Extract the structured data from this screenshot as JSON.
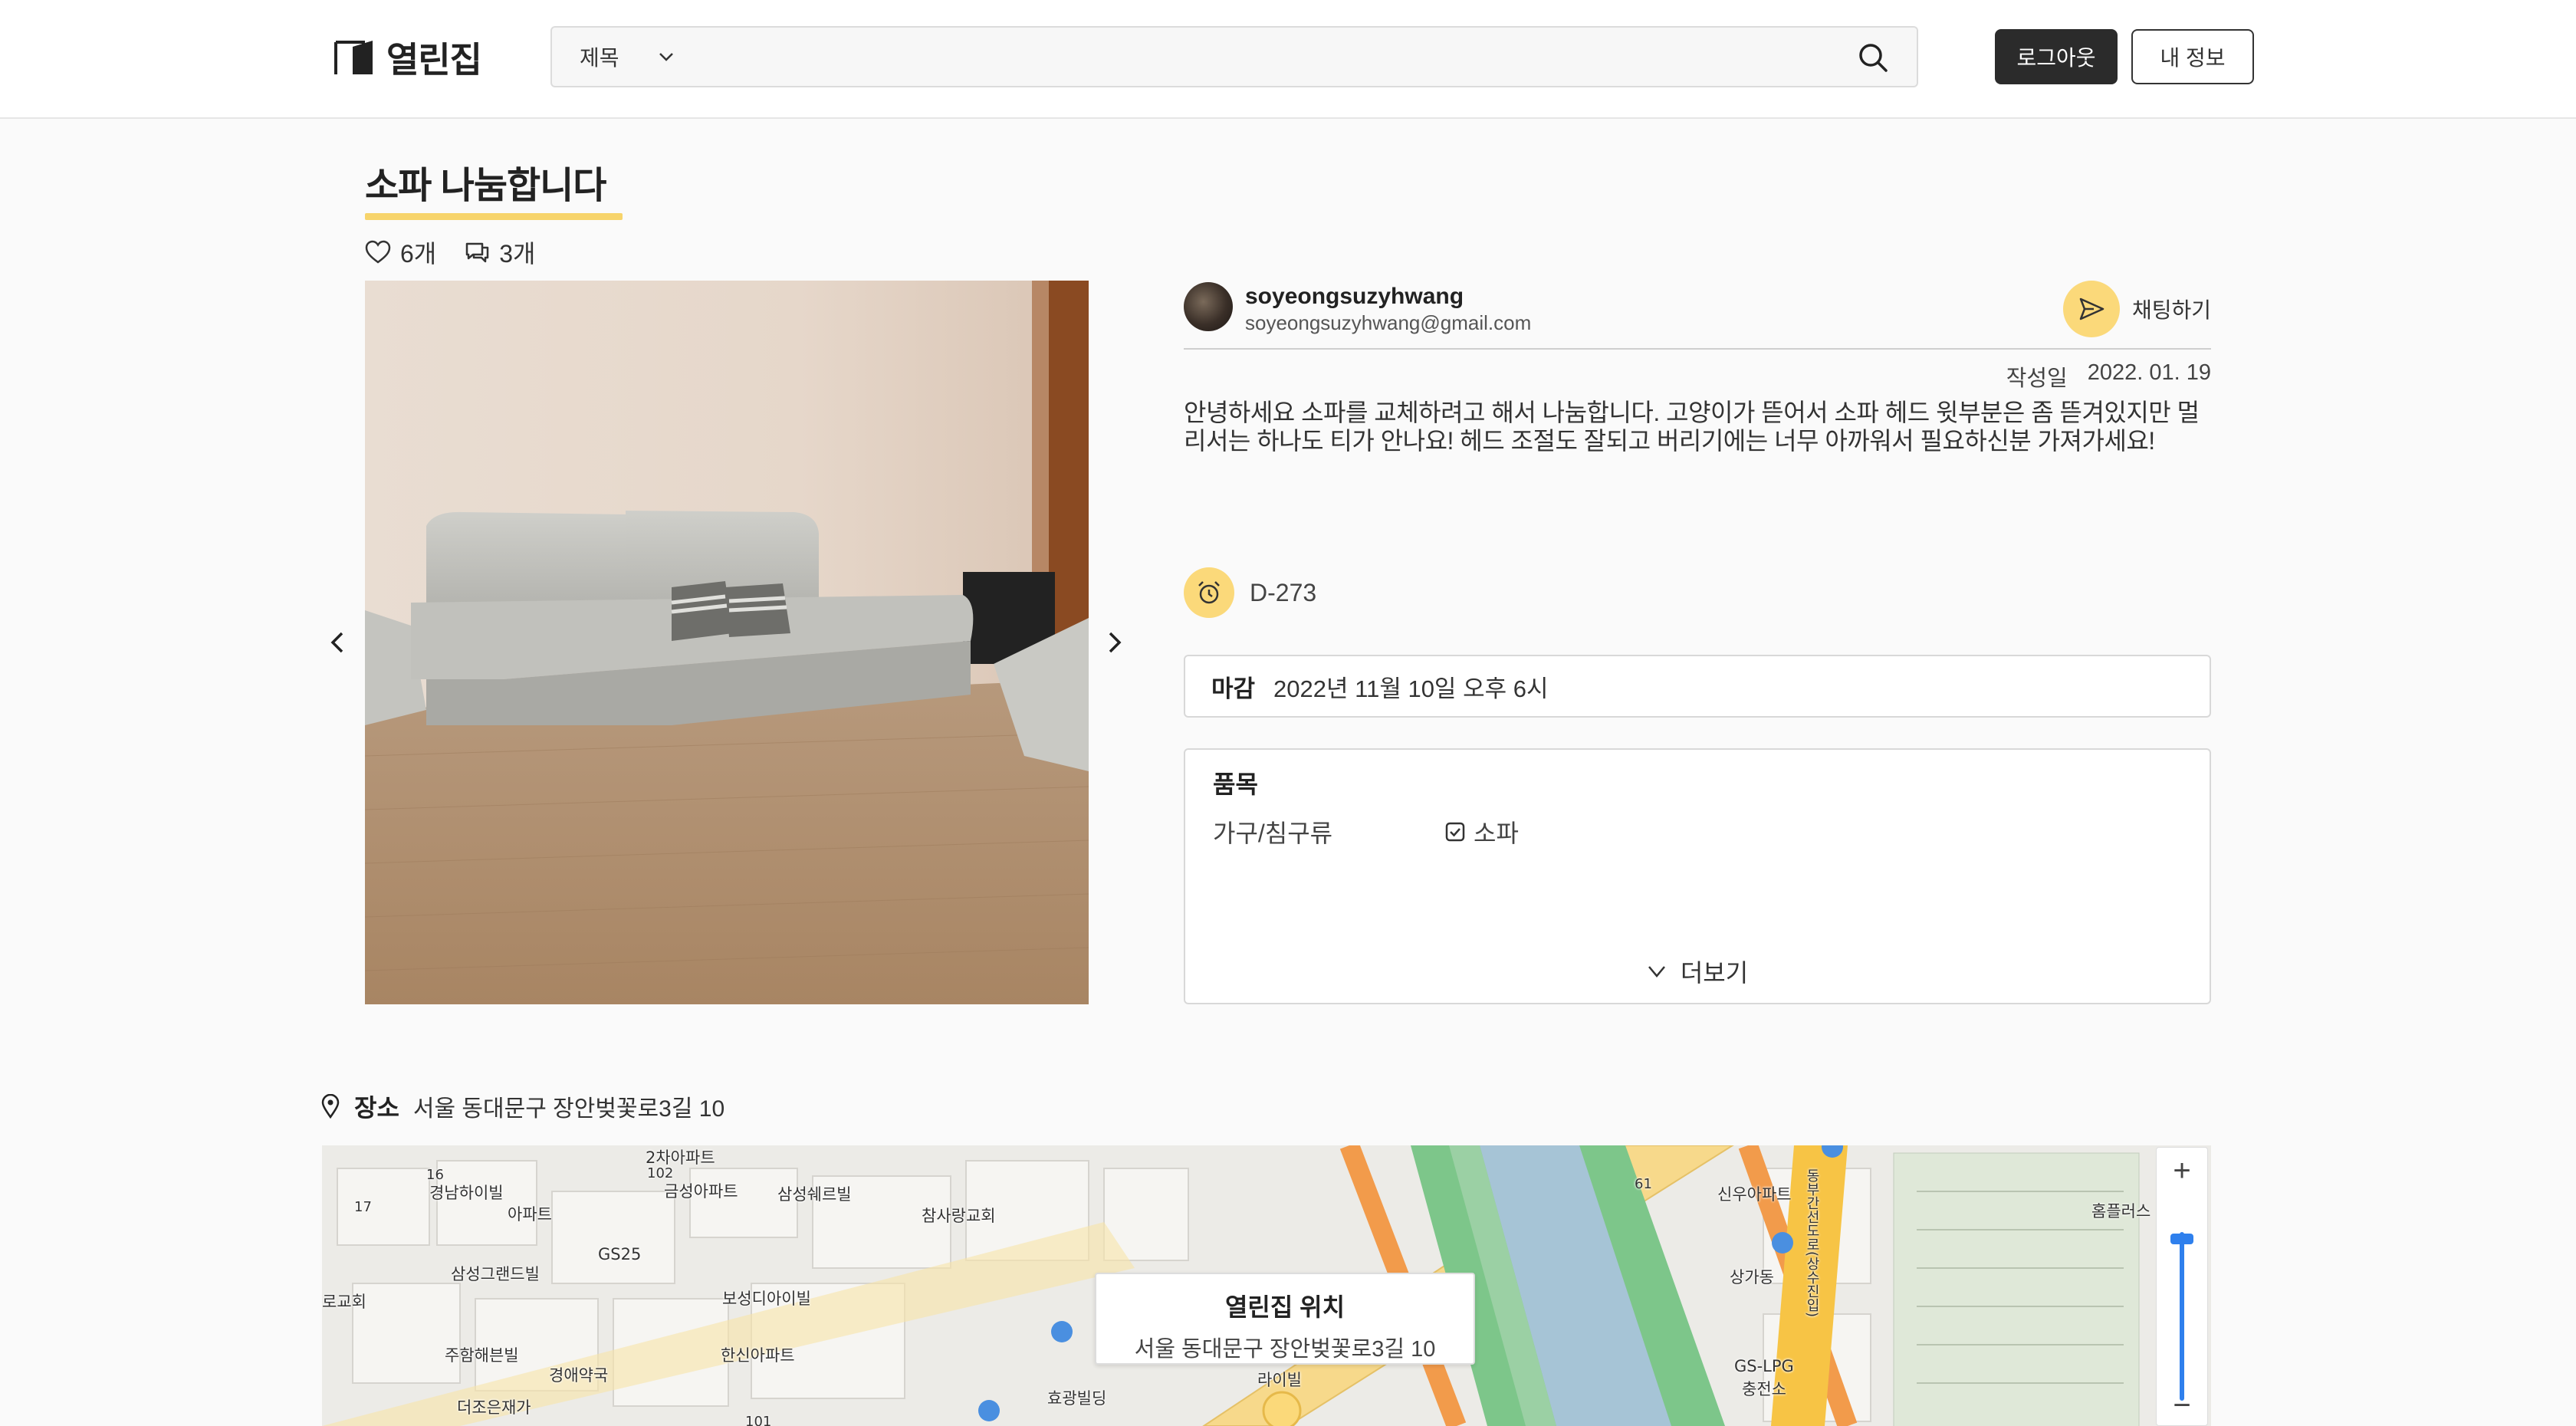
{
  "header": {
    "logo_text": "열린집",
    "search_select": "제목",
    "search_placeholder": "",
    "logout_label": "로그아웃",
    "myinfo_label": "내 정보"
  },
  "post": {
    "title": "소파 나눔합니다",
    "likes": "6개",
    "comments": "3개",
    "author_name": "soyeongsuzyhwang",
    "author_email": "soyeongsuzyhwang@gmail.com",
    "chat_label": "채팅하기",
    "date_label": "작성일",
    "date_value": "2022. 01. 19",
    "description": "안녕하세요 소파를 교체하려고 해서 나눔합니다. 고양이가 뜯어서 소파 헤드 윗부분은 좀 뜯겨있지만 멀리서는 하나도 티가 안나요! 헤드 조절도 잘되고 버리기에는 너무 아까워서 필요하신분 가져가세요!",
    "dday": "D-273",
    "deadline_label": "마감",
    "deadline_value": "2022년 11월 10일 오후 6시",
    "items_title": "품목",
    "items_category": "가구/침구류",
    "items_checked": "소파",
    "more_label": "더보기"
  },
  "location": {
    "label": "장소",
    "address": "서울 동대문구 장안벚꽃로3길 10",
    "popup_title": "열린집 위치",
    "popup_address": "서울 동대문구 장안벚꽃로3길 10",
    "zoom_in": "+",
    "zoom_out": "−",
    "map_labels": {
      "l1": "2차아파트",
      "l2": "경남하이빌",
      "l3": "아파트",
      "l4": "금성아파트",
      "l5": "삼성쉐르빌",
      "l6": "참사랑교회",
      "l7": "GS25",
      "l8": "삼성그랜드빌",
      "l9": "보성디아이빌",
      "l10": "주함해븐빌",
      "l11": "경애약국",
      "l12": "한신아파트",
      "l13": "더조은재가",
      "l14": "효광빌딩",
      "l15": "신우아파트",
      "l16": "상가동",
      "l17": "GS-LPG",
      "l18": "충전소",
      "l19": "홈플러스",
      "l20": "동부간선도로(상수진입)",
      "l21": "로교회",
      "l22": "라이빌",
      "l23": "16",
      "l24": "17",
      "l25": "102",
      "l26": "101",
      "l27": "61"
    }
  },
  "colors": {
    "accent": "#fbd97a",
    "underline": "#f7d46b",
    "dark_button": "#2b2b2b",
    "map_river": "#a6c4d6",
    "map_park": "#7dc68a",
    "map_road_orange": "#f29b4b",
    "map_road_yellow": "#f7d98b"
  }
}
